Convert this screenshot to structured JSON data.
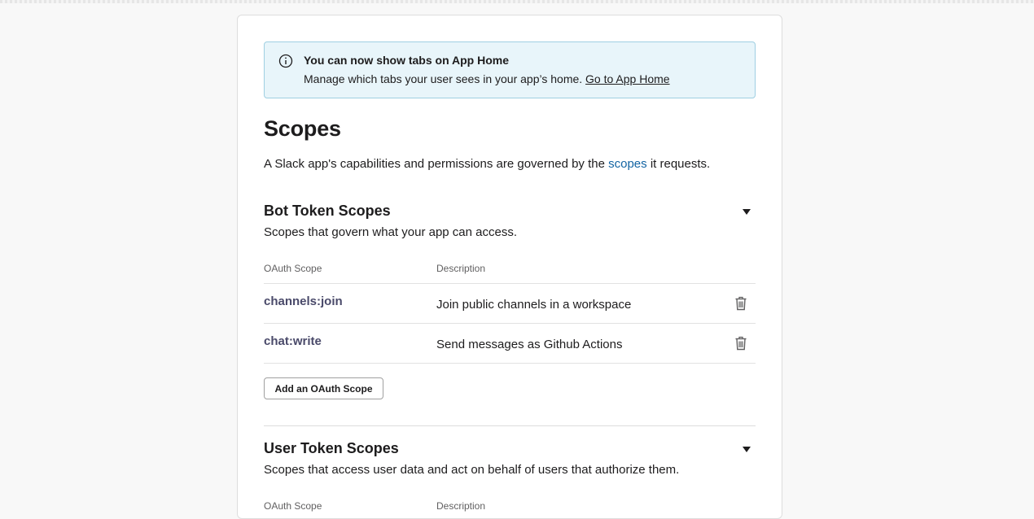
{
  "banner": {
    "title": "You can now show tabs on App Home",
    "body": "Manage which tabs your user sees in your app’s home.",
    "link": "Go to App Home"
  },
  "page": {
    "title": "Scopes",
    "intro_before": "A Slack app's capabilities and permissions are governed by the",
    "intro_link": "scopes",
    "intro_after": "it requests."
  },
  "bot_section": {
    "title": "Bot Token Scopes",
    "subtitle": "Scopes that govern what your app can access.",
    "columns": [
      "OAuth Scope",
      "Description"
    ],
    "rows": [
      {
        "scope": "channels:join",
        "description": "Join public channels in a workspace"
      },
      {
        "scope": "chat:write",
        "description": "Send messages as Github Actions"
      }
    ],
    "add_button": "Add an OAuth Scope"
  },
  "user_section": {
    "title": "User Token Scopes",
    "subtitle": "Scopes that access user data and act on behalf of users that authorize them.",
    "columns": [
      "OAuth Scope",
      "Description"
    ]
  },
  "icons": {
    "info": "info-circle-icon",
    "caret": "caret-down-icon",
    "delete": "trash-icon"
  },
  "colors": {
    "banner_bg": "#e8f5fa",
    "banner_border": "#9fcfe2",
    "link": "#1264a3",
    "scope_text": "#4a4a6a"
  }
}
